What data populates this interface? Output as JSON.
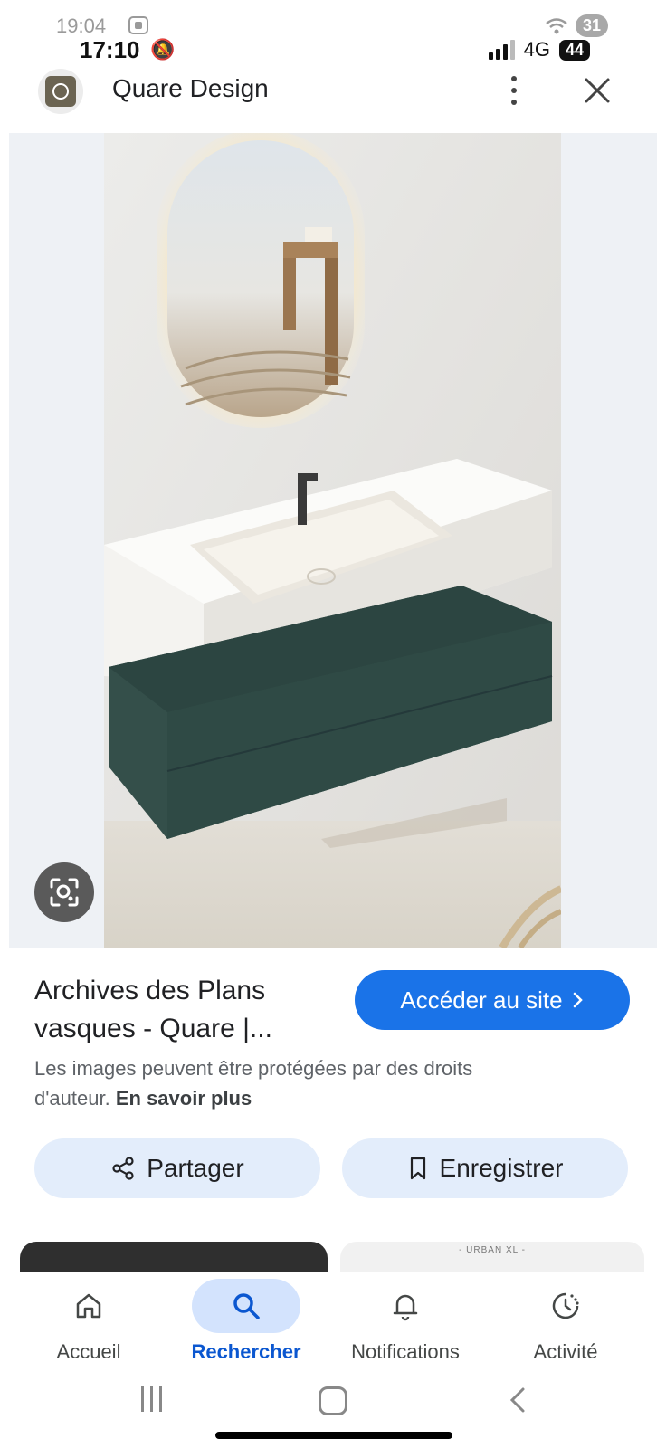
{
  "status_back": {
    "time": "19:04",
    "badge": "31"
  },
  "status_front": {
    "time": "17:10",
    "network": "4G",
    "battery": "44"
  },
  "header": {
    "site_name": "Quare Design"
  },
  "result": {
    "title": "Archives des Plans vasques - Quare |...",
    "visit_label": "Accéder au site",
    "copyright_text": "Les images peuvent être protégées par des droits d'auteur.",
    "learn_more": "En savoir plus"
  },
  "actions": {
    "share_label": "Partager",
    "save_label": "Enregistrer"
  },
  "thumbnails": {
    "right_caption": "- URBAN XL -"
  },
  "bottom_nav": {
    "items": [
      {
        "label": "Accueil",
        "icon": "home-icon"
      },
      {
        "label": "Rechercher",
        "icon": "search-icon",
        "active": true
      },
      {
        "label": "Notifications",
        "icon": "bell-icon"
      },
      {
        "label": "Activité",
        "icon": "activity-icon"
      }
    ]
  },
  "colors": {
    "accent": "#1a73e8",
    "chip": "#e3edfb",
    "active_nav": "#d3e3fd",
    "cabinet": "#2f4a45"
  }
}
